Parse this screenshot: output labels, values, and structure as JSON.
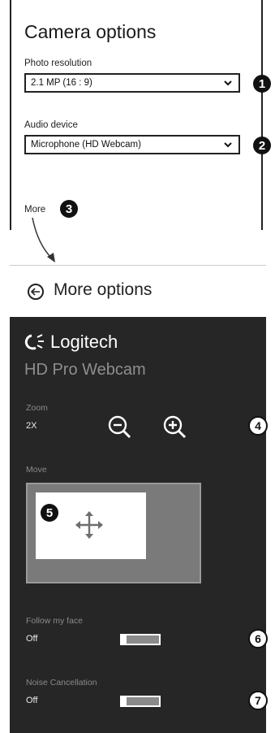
{
  "camera_options": {
    "title": "Camera options",
    "photo_resolution": {
      "label": "Photo resolution",
      "value": "2.1 MP (16 : 9)"
    },
    "audio_device": {
      "label": "Audio device",
      "value": "Microphone (HD Webcam)"
    },
    "more_link": "More"
  },
  "more_options": {
    "title": "More options",
    "brand": "Logitech",
    "product": "HD Pro Webcam",
    "zoom": {
      "label": "Zoom",
      "value": "2X"
    },
    "move_label": "Move",
    "follow_face": {
      "label": "Follow my face",
      "value": "Off"
    },
    "noise_cancellation": {
      "label": "Noise Cancellation",
      "value": "Off"
    }
  },
  "callouts": [
    "1",
    "2",
    "3",
    "4",
    "5",
    "6",
    "7"
  ],
  "colors": {
    "dark_panel": "#262626",
    "move_area": "#7a7a7a"
  }
}
